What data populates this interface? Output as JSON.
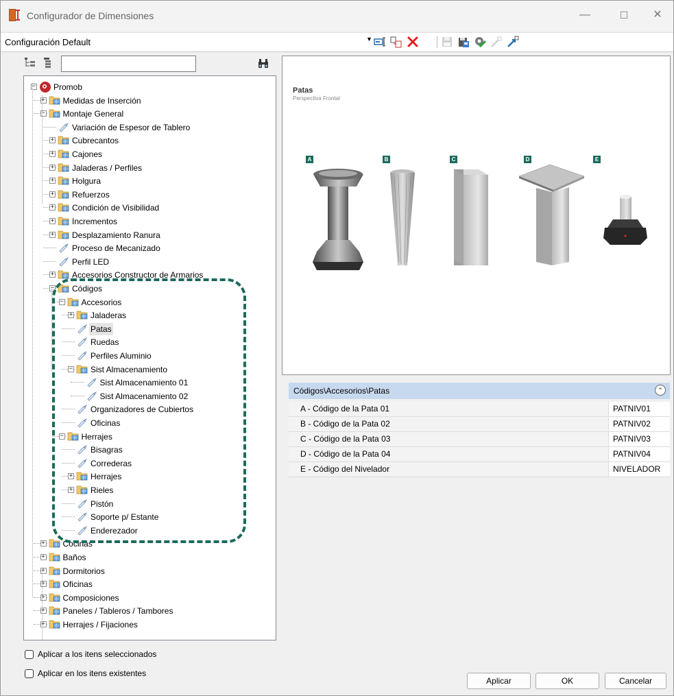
{
  "window": {
    "title": "Configurador de Dimensiones",
    "minimize": "—",
    "maximize": "☐",
    "close": "✕"
  },
  "config": {
    "current": "Configuración Default"
  },
  "tree": {
    "search_value": "",
    "nodes": [
      {
        "label": "Promob"
      },
      {
        "label": "Medidas de Inserción"
      },
      {
        "label": "Montaje General"
      },
      {
        "label": "Variación de Espesor de Tablero"
      },
      {
        "label": "Cubrecantos"
      },
      {
        "label": "Cajones"
      },
      {
        "label": "Jaladeras / Perfiles"
      },
      {
        "label": "Holgura"
      },
      {
        "label": "Refuerzos"
      },
      {
        "label": "Condición de Visibilidad"
      },
      {
        "label": "Incrementos"
      },
      {
        "label": "Desplazamiento Ranura"
      },
      {
        "label": "Proceso de Mecanizado"
      },
      {
        "label": "Perfil LED"
      },
      {
        "label": "Accesorios Constructor de Armarios"
      },
      {
        "label": "Códigos"
      },
      {
        "label": "Accesorios"
      },
      {
        "label": "Jaladeras"
      },
      {
        "label": "Patas"
      },
      {
        "label": "Ruedas"
      },
      {
        "label": "Perfiles Aluminio"
      },
      {
        "label": "Sist Almacenamiento"
      },
      {
        "label": "Sist Almacenamiento 01"
      },
      {
        "label": "Sist Almacenamiento 02"
      },
      {
        "label": "Organizadores de Cubiertos"
      },
      {
        "label": "Oficinas"
      },
      {
        "label": "Herrajes"
      },
      {
        "label": "Bisagras"
      },
      {
        "label": "Correderas"
      },
      {
        "label": "Herrajes"
      },
      {
        "label": "Rieles"
      },
      {
        "label": "Pistón"
      },
      {
        "label": "Soporte p/ Estante"
      },
      {
        "label": "Enderezador"
      },
      {
        "label": "Cocinas"
      },
      {
        "label": "Baños"
      },
      {
        "label": "Dormitorios"
      },
      {
        "label": "Oficinas"
      },
      {
        "label": "Composiciones"
      },
      {
        "label": "Paneles / Tableros / Tambores"
      },
      {
        "label": "Herrajes / Fijaciones"
      }
    ]
  },
  "preview": {
    "title": "Patas",
    "subtitle": "Perspectiva Frontal",
    "labels": [
      "A",
      "B",
      "C",
      "D",
      "E"
    ]
  },
  "properties": {
    "path": "Códigos\\Accesorios\\Patas",
    "rows": [
      {
        "name": "A - Código de la Pata 01",
        "value": "PATNIV01"
      },
      {
        "name": "B - Código de la Pata 02",
        "value": "PATNIV02"
      },
      {
        "name": "C - Código de la Pata 03",
        "value": "PATNIV03"
      },
      {
        "name": "D - Código de la Pata 04",
        "value": "PATNIV04"
      },
      {
        "name": "E - Código del Nivelador",
        "value": "NIVELADOR"
      }
    ]
  },
  "options": {
    "apply_selected": "Aplicar a los itens seleccionados",
    "apply_existing": "Aplicar en los itens existentes"
  },
  "buttons": {
    "apply": "Aplicar",
    "ok": "OK",
    "cancel": "Cancelar"
  },
  "colors": {
    "accent": "#1a6b5b",
    "header": "#c7d9ee"
  }
}
